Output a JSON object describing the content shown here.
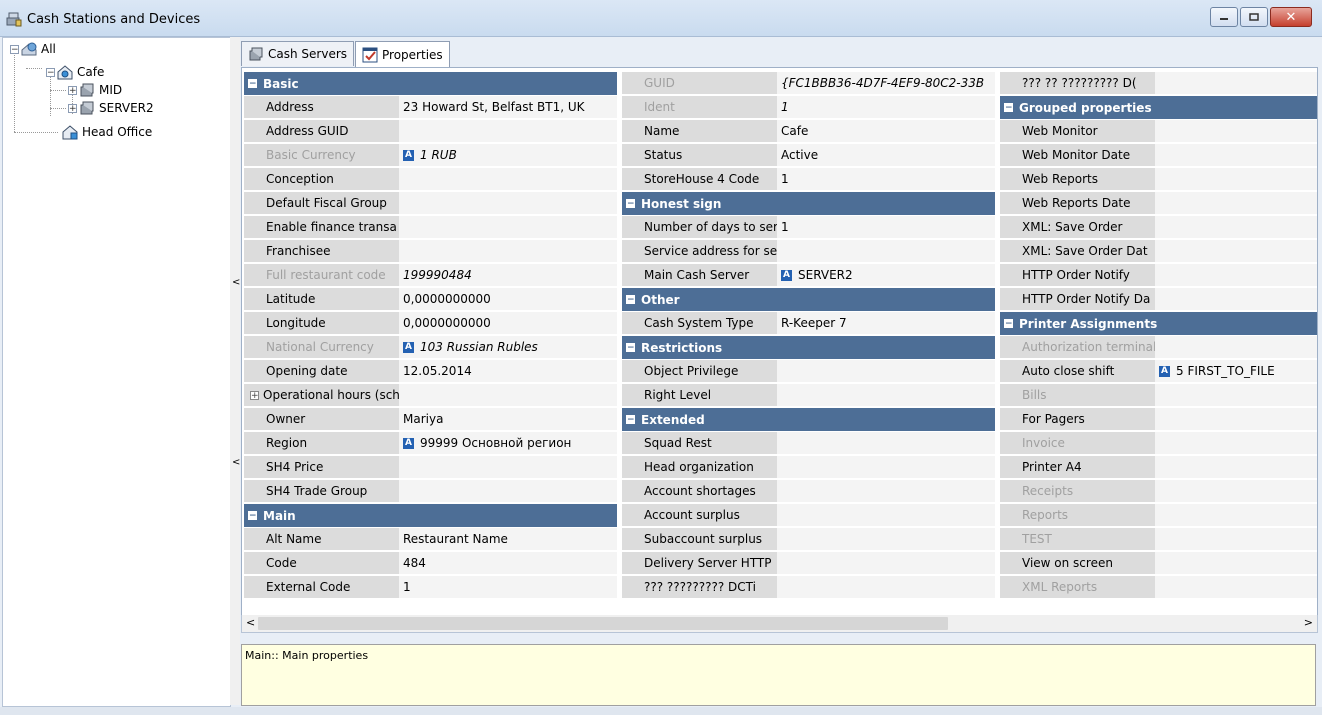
{
  "window": {
    "title": "Cash Stations and Devices",
    "icon": "cash-station-icon"
  },
  "tree": {
    "nodes": [
      {
        "label": "All",
        "icon": "globe-icon",
        "expander": "−"
      },
      {
        "label": "Cafe",
        "icon": "restaurant-icon",
        "expander": "−"
      },
      {
        "label": "MID",
        "icon": "server-icon",
        "expander": "+"
      },
      {
        "label": "SERVER2",
        "icon": "server-icon",
        "expander": "+"
      },
      {
        "label": "Head Office",
        "icon": "office-icon",
        "expander": ""
      }
    ]
  },
  "tabs": [
    {
      "label": "Cash Servers",
      "icon": "cash-server-icon"
    },
    {
      "label": "Properties",
      "icon": "properties-icon"
    }
  ],
  "col1": [
    {
      "type": "section",
      "label": "Basic"
    },
    {
      "name": "Address",
      "value": "23 Howard St, Belfast BT1, UK"
    },
    {
      "name": "Address GUID",
      "value": ""
    },
    {
      "name": "Basic Currency",
      "value": "1 RUB",
      "dim": true,
      "italic": true,
      "ref": true
    },
    {
      "name": "Conception",
      "value": ""
    },
    {
      "name": "Default Fiscal Group",
      "value": ""
    },
    {
      "name": "Enable finance transa",
      "value": ""
    },
    {
      "name": "Franchisee",
      "value": ""
    },
    {
      "name": "Full restaurant code",
      "value": "199990484",
      "dim": true,
      "italic": true
    },
    {
      "name": "Latitude",
      "value": "0,0000000000"
    },
    {
      "name": "Longitude",
      "value": "0,0000000000"
    },
    {
      "name": "National Currency",
      "value": "103 Russian Rubles",
      "dim": true,
      "italic": true,
      "ref": true
    },
    {
      "name": "Opening date",
      "value": "12.05.2014"
    },
    {
      "name": "Operational hours (sch",
      "value": "",
      "expand": true
    },
    {
      "name": "Owner",
      "value": "Mariya"
    },
    {
      "name": "Region",
      "value": "99999 Основной регион",
      "ref": true
    },
    {
      "name": "SH4 Price",
      "value": ""
    },
    {
      "name": "SH4 Trade Group",
      "value": ""
    },
    {
      "type": "section",
      "label": "Main"
    },
    {
      "name": "Alt Name",
      "value": "Restaurant Name"
    },
    {
      "name": "Code",
      "value": "484"
    },
    {
      "name": "External Code",
      "value": "1"
    }
  ],
  "col2": [
    {
      "name": "GUID",
      "value": "{FC1BBB36-4D7F-4EF9-80C2-33B",
      "dim": true,
      "italic": true
    },
    {
      "name": "Ident",
      "value": "1",
      "dim": true,
      "italic": true
    },
    {
      "name": "Name",
      "value": "Cafe"
    },
    {
      "name": "Status",
      "value": "Active"
    },
    {
      "name": "StoreHouse 4 Code",
      "value": "1"
    },
    {
      "type": "section",
      "label": "Honest sign"
    },
    {
      "name": "Number of days to ser",
      "value": "1"
    },
    {
      "name": "Service address for se",
      "value": ""
    },
    {
      "name": "Main Cash Server",
      "value": "SERVER2",
      "ref": true
    },
    {
      "type": "section",
      "label": "Other"
    },
    {
      "name": "Cash System Type",
      "value": "R-Keeper 7"
    },
    {
      "type": "section",
      "label": "Restrictions"
    },
    {
      "name": "Object Privilege",
      "value": ""
    },
    {
      "name": "Right Level",
      "value": ""
    },
    {
      "type": "section",
      "label": "Extended"
    },
    {
      "name": "Squad Rest",
      "value": ""
    },
    {
      "name": "Head organization",
      "value": ""
    },
    {
      "name": "Account shortages",
      "value": ""
    },
    {
      "name": "Account surplus",
      "value": ""
    },
    {
      "name": "Subaccount surplus",
      "value": ""
    },
    {
      "name": "Delivery Server HTTP",
      "value": ""
    },
    {
      "name": "??? ????????? DCTi",
      "value": ""
    }
  ],
  "col3": [
    {
      "name": "??? ?? ????????? D(",
      "value": ""
    },
    {
      "type": "section",
      "label": "Grouped properties"
    },
    {
      "name": "Web Monitor",
      "value": ""
    },
    {
      "name": "Web Monitor Date",
      "value": ""
    },
    {
      "name": "Web Reports",
      "value": ""
    },
    {
      "name": "Web Reports Date",
      "value": ""
    },
    {
      "name": "XML: Save Order",
      "value": ""
    },
    {
      "name": "XML: Save Order Dat",
      "value": ""
    },
    {
      "name": "HTTP Order Notify",
      "value": ""
    },
    {
      "name": "HTTP Order Notify Da",
      "value": ""
    },
    {
      "type": "section",
      "label": "Printer Assignments"
    },
    {
      "name": "Authorization terminal",
      "value": "",
      "dim": true
    },
    {
      "name": "Auto close shift",
      "value": "5 FIRST_TO_FILE",
      "ref": true
    },
    {
      "name": "Bills",
      "value": "",
      "dim": true
    },
    {
      "name": "For Pagers",
      "value": ""
    },
    {
      "name": "Invoice",
      "value": "",
      "dim": true
    },
    {
      "name": "Printer A4",
      "value": ""
    },
    {
      "name": "Receipts",
      "value": "",
      "dim": true
    },
    {
      "name": "Reports",
      "value": "",
      "dim": true
    },
    {
      "name": "TEST",
      "value": "",
      "dim": true
    },
    {
      "name": "View on screen",
      "value": ""
    },
    {
      "name": "XML Reports",
      "value": "",
      "dim": true
    }
  ],
  "scrollbar": {
    "left_arrow": "<",
    "right_arrow": ">"
  },
  "description": "Main:: Main properties",
  "colors": {
    "section": "#4d6e96",
    "name_bg": "#dcdcdc",
    "value_bg": "#f4f4f4",
    "desc_bg": "#ffffe1",
    "ref_icon": "#2461b2"
  }
}
